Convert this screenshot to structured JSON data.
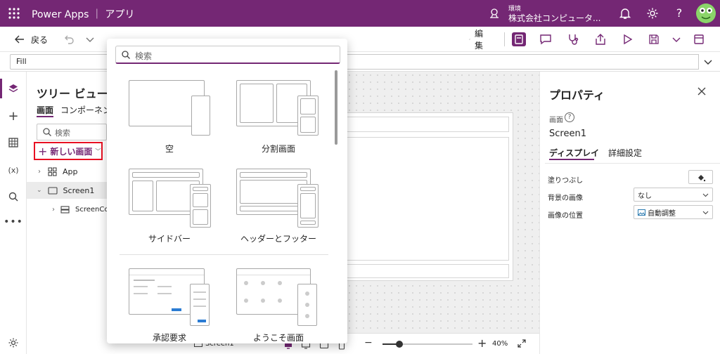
{
  "topbar": {
    "app_title": "Power Apps ｜ アプリ",
    "env_label": "環境",
    "env_name": "株式会社コンピュータ..."
  },
  "command": {
    "back_label": "戻る",
    "edit_label": "編集"
  },
  "formula": {
    "property": "Fill"
  },
  "tree": {
    "title": "ツリー ビュー",
    "tab_screens": "画面",
    "tab_components": "コンポーネン",
    "search_placeholder": "検索",
    "new_screen": "新しい画面",
    "rows": [
      "App",
      "Screen1",
      "ScreenCo"
    ]
  },
  "popup": {
    "search_placeholder": "検索",
    "templates": [
      "空",
      "分割画面",
      "サイドバー",
      "ヘッダーとフッター",
      "承認要求",
      "ようこそ画面"
    ]
  },
  "props": {
    "title": "プロパティ",
    "kind": "画面",
    "name": "Screen1",
    "tab_display": "ディスプレイ",
    "tab_advanced": "詳細設定",
    "fill_label": "塗りつぶし",
    "bg_image_label": "背景の画像",
    "bg_image_value": "なし",
    "image_pos_label": "画像の位置",
    "image_pos_value": "自動調整"
  },
  "bottombar": {
    "screen_name": "Screen1",
    "zoom": "40%",
    "zoom_level": 0.4
  },
  "colors": {
    "brand": "#742774",
    "accent_red": "#e81123"
  }
}
